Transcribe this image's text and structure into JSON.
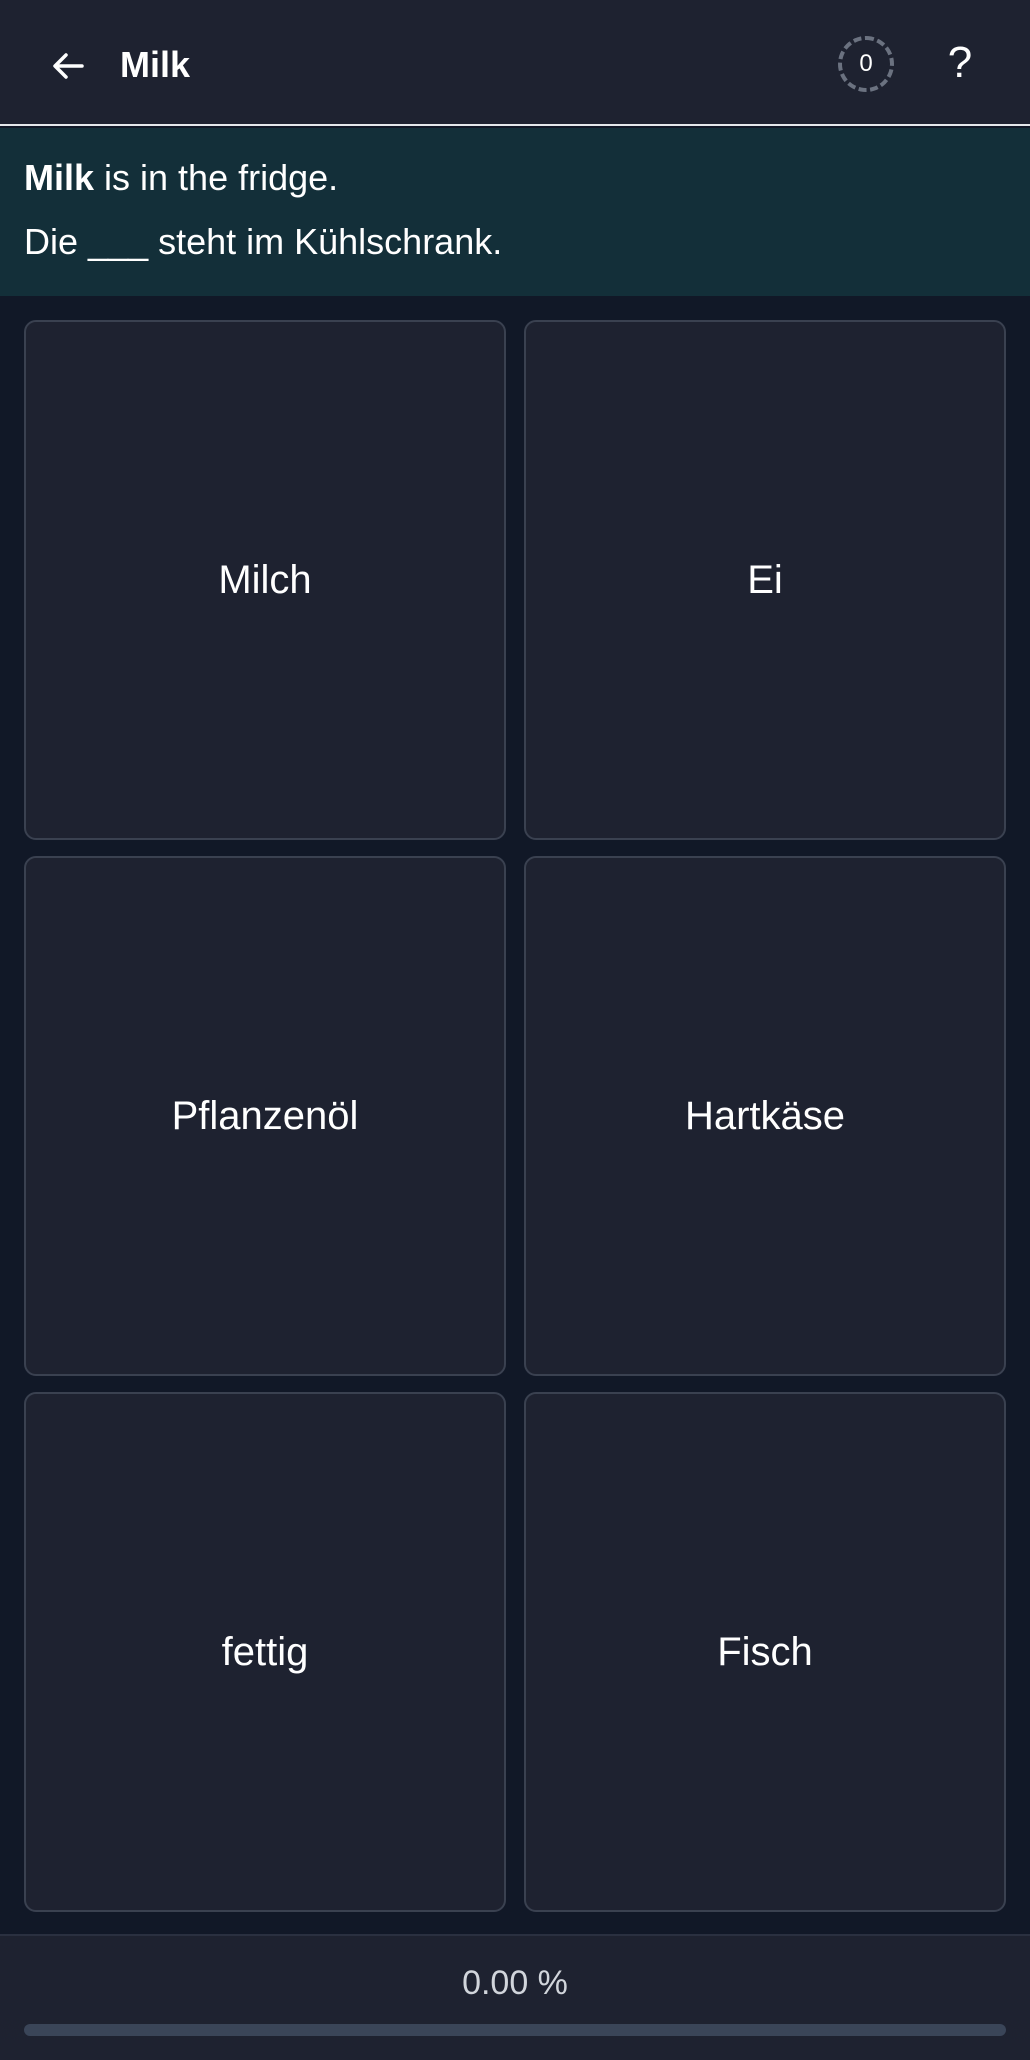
{
  "header": {
    "back_icon": "arrow-left-icon",
    "title": "Milk",
    "counter": "0",
    "help_label": "?"
  },
  "prompt": {
    "english_bold": "Milk",
    "english_rest": " is in the fridge.",
    "german_sentence": "Die ___ steht im Kühlschrank."
  },
  "options": [
    {
      "label": "Milch"
    },
    {
      "label": "Ei"
    },
    {
      "label": "Pflanzenöl"
    },
    {
      "label": "Hartkäse"
    },
    {
      "label": "fettig"
    },
    {
      "label": "Fisch"
    }
  ],
  "progress": {
    "label": "0.00 %",
    "fraction": 0
  },
  "colors": {
    "background": "#111827",
    "panel": "#1e2230",
    "prompt_bg": "#132f39",
    "progress_track": "#3a4558"
  }
}
